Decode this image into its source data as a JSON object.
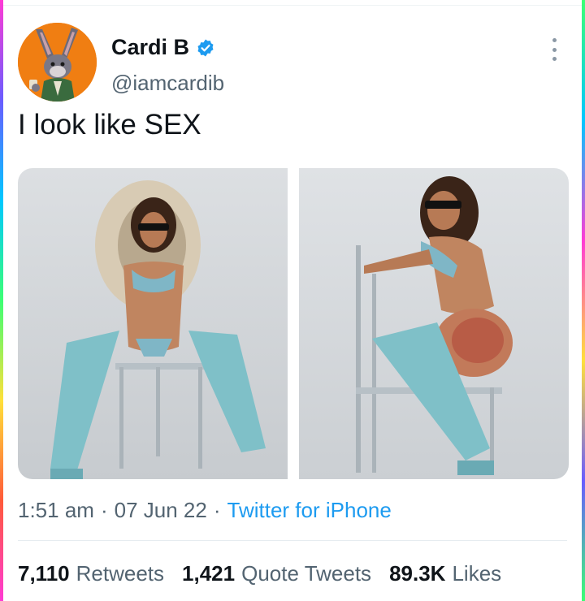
{
  "author": {
    "display_name": "Cardi B",
    "handle": "@iamcardib",
    "avatar_icon": "bunny-avatar-icon",
    "verified_icon": "verified-badge-icon",
    "avatar_color": "#f07e12",
    "verified_color": "#1d9bf0"
  },
  "more_icon": "more-options-icon",
  "tweet": {
    "text": "I look like SEX"
  },
  "media": [
    {
      "label": "photo-1"
    },
    {
      "label": "photo-2"
    }
  ],
  "meta": {
    "time": "1:51 am",
    "sep1": "·",
    "date": "07 Jun 22",
    "sep2": "·",
    "source": "Twitter for iPhone"
  },
  "stats": {
    "retweets_count": "7,110",
    "retweets_label": "Retweets",
    "quotes_count": "1,421",
    "quotes_label": "Quote Tweets",
    "likes_count": "89.3K",
    "likes_label": "Likes"
  },
  "colors": {
    "link": "#1d9bf0",
    "secondary_text": "#536471",
    "primary_text": "#0f1419"
  }
}
